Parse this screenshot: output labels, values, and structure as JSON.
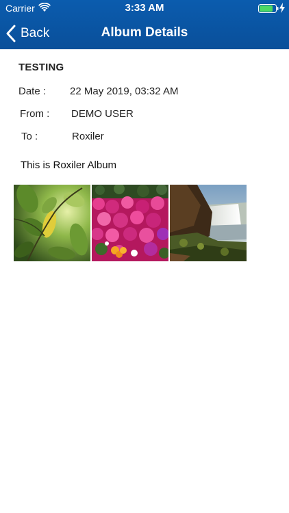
{
  "status_bar": {
    "carrier": "Carrier",
    "time": "3:33 AM",
    "battery_color": "#4cd964"
  },
  "nav": {
    "back_label": "Back",
    "title": "Album Details",
    "bar_color": "#0b5cae"
  },
  "album": {
    "name": "TESTING",
    "date_label": "Date :",
    "date_value": "22 May 2019, 03:32 AM",
    "from_label": "From :",
    "from_value": "DEMO USER",
    "to_label": "To :",
    "to_value": "Roxiler",
    "description": "This is Roxiler Album"
  },
  "photos": [
    {
      "subject": "green leaves with yellow leaf"
    },
    {
      "subject": "pink and purple flowers"
    },
    {
      "subject": "waterfall with rocky cliff"
    }
  ]
}
